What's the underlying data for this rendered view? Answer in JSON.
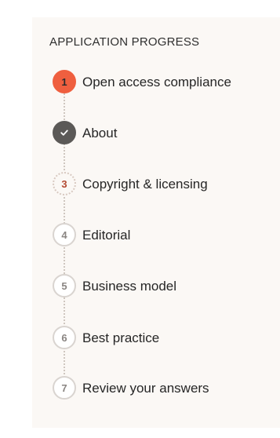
{
  "progress": {
    "title": "APPLICATION PROGRESS",
    "steps": [
      {
        "number": "1",
        "label": "Open access compliance",
        "state": "current"
      },
      {
        "number": "",
        "label": "About",
        "state": "done"
      },
      {
        "number": "3",
        "label": "Copyright & licensing",
        "state": "next"
      },
      {
        "number": "4",
        "label": "Editorial",
        "state": "future"
      },
      {
        "number": "5",
        "label": "Business model",
        "state": "future"
      },
      {
        "number": "6",
        "label": "Best practice",
        "state": "future"
      },
      {
        "number": "7",
        "label": "Review your answers",
        "state": "future"
      }
    ]
  },
  "colors": {
    "current": "#ef5f3f",
    "done": "#5b5957",
    "panel_background": "#fbf8f5"
  },
  "icons": {
    "done_step": "check-icon"
  }
}
